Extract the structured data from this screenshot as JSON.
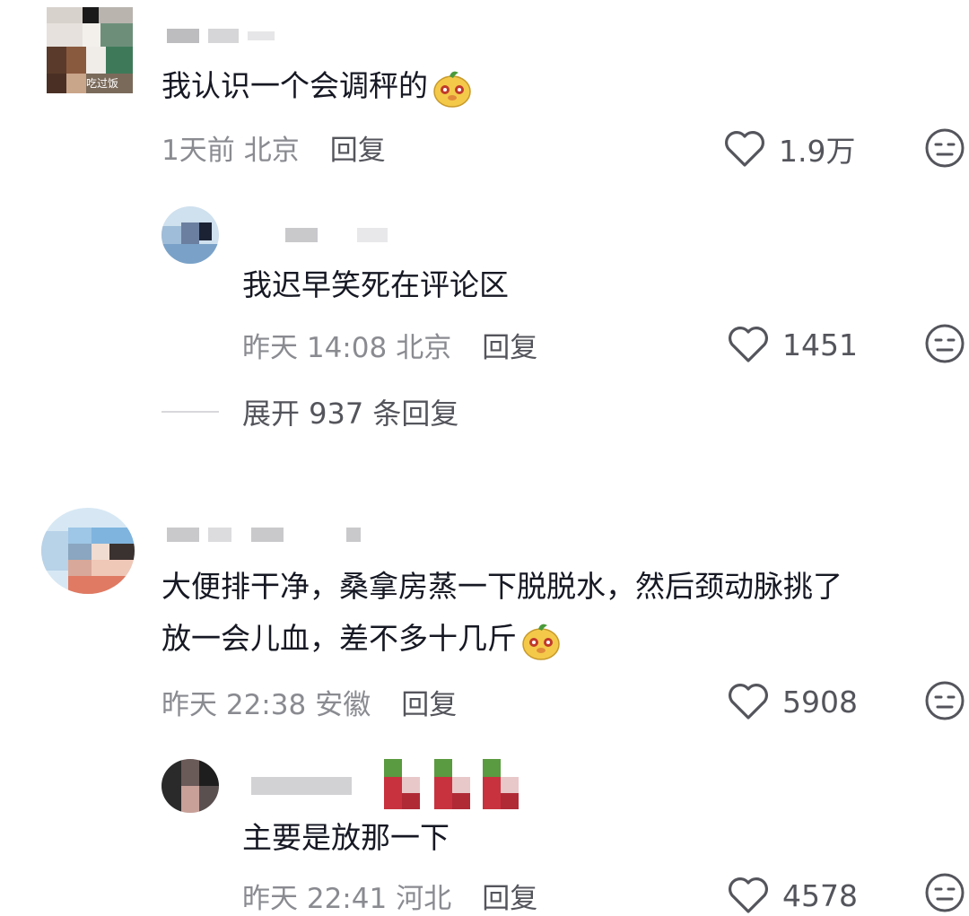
{
  "colors": {
    "text": "#161823",
    "meta": "#8a8b91",
    "action": "#54555c",
    "emoji_face": "#f4c94a",
    "emoji_leaf": "#4a9a3a"
  },
  "comments": [
    {
      "text": "我认识一个会调秤的",
      "emoji": "yellow-bear-emoji",
      "time": "1天前",
      "location": "北京",
      "reply_label": "回复",
      "likes": "1.9万",
      "avatar_caption": "吃过饭",
      "replies": [
        {
          "text": "我迟早笑死在评论区",
          "time": "昨天 14:08",
          "location": "北京",
          "reply_label": "回复",
          "likes": "1451"
        }
      ],
      "expand_label": "展开 937 条回复"
    },
    {
      "text_line1": "大便排干净，桑拿房蒸一下脱脱水，然后颈动脉挑了",
      "text_line2": "放一会儿血，差不多十几斤",
      "emoji": "yellow-bear-emoji",
      "time": "昨天 22:38",
      "location": "安徽",
      "reply_label": "回复",
      "likes": "5908",
      "replies": [
        {
          "text": "主要是放那一下",
          "time": "昨天 22:41",
          "location": "河北",
          "reply_label": "回复",
          "likes": "4578"
        }
      ]
    }
  ]
}
